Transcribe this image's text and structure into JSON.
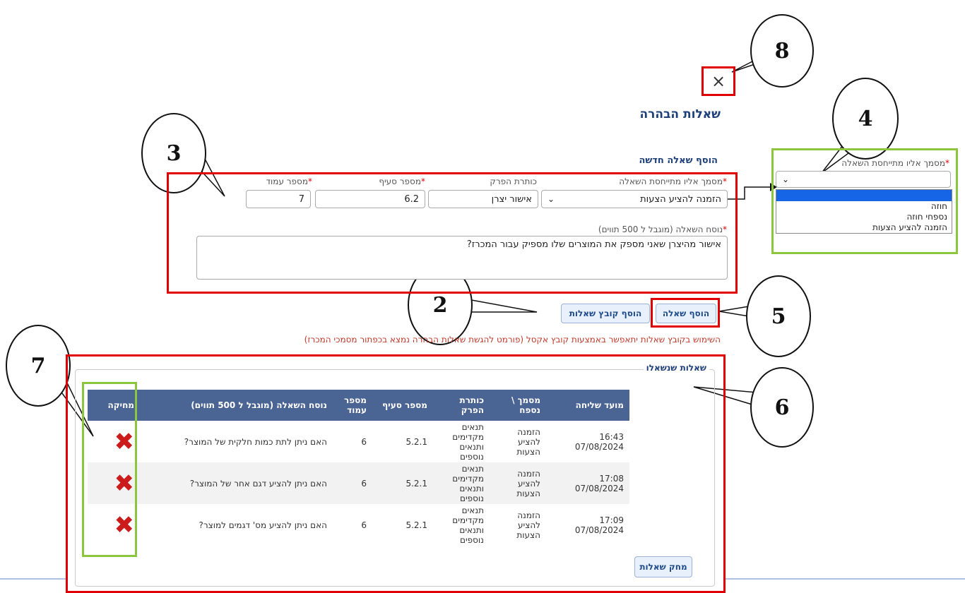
{
  "dialog": {
    "title": "שאלות הבהרה",
    "close_icon": "close-icon",
    "close_glyph": "×"
  },
  "new_question": {
    "section_title": "הוסף שאלה חדשה",
    "document_label": "מסמך אליו מתייחסת השאלה",
    "document_value": "הזמנה להציע הצעות",
    "chapter_label": "כותרת הפרק",
    "chapter_value": "אישור יצרן",
    "section_label": "מספר סעיף",
    "section_value": "6.2",
    "page_label": "מספר עמוד",
    "page_value": "7",
    "text_label": "נוסח השאלה (מוגבל ל 500 תווים)",
    "text_value": "אישור מהיצרן שאני מספק את המוצרים שלו מספיק עבור המכרז?",
    "required_mark": "*"
  },
  "dropdown_zoom": {
    "label": "מסמך אליו מתייחסת השאלה",
    "options": [
      "",
      "חוזה",
      "נספחי חוזה",
      "הזמנה להציע הצעות"
    ]
  },
  "buttons": {
    "add_question": "הוסף שאלה",
    "add_file": "הוסף קובץ שאלות",
    "delete_questions": "מחק שאלות"
  },
  "note": "השימוש בקובץ שאלות יתאפשר באמצעות קובץ אקסל (פורמט להגשת שאלות הבהרה נמצא בכפתור מסמכי המכרז)",
  "asked": {
    "legend": "שאלות שנשאלו",
    "columns": [
      "מועד שליחה",
      "מסמך \\ נספח",
      "כותרת הפרק",
      "מספר סעיף",
      "מספר עמוד",
      "נוסח השאלה (מוגבל ל 500 תווים)",
      "מחיקה"
    ],
    "rows": [
      {
        "date": "16:43 07/08/2024",
        "doc": "הזמנה להציע הצעות",
        "chapter": "תנאים מקדימים ותנאים נוספים",
        "section": "5.2.1",
        "page": "6",
        "text": "האם ניתן לתת כמות חלקית של המוצר?"
      },
      {
        "date": "17:08 07/08/2024",
        "doc": "הזמנה להציע הצעות",
        "chapter": "תנאים מקדימים ותנאים נוספים",
        "section": "5.2.1",
        "page": "6",
        "text": "האם ניתן להציע דגם אחר של המוצר?"
      },
      {
        "date": "17:09 07/08/2024",
        "doc": "הזמנה להציע הצעות",
        "chapter": "תנאים מקדימים ותנאים נוספים",
        "section": "5.2.1",
        "page": "6",
        "text": "האם ניתן להציע מס' דגמים למוצר?"
      }
    ],
    "delete_icon": "delete-x-icon",
    "delete_glyph": "✖"
  },
  "callouts": [
    "8",
    "4",
    "3",
    "2",
    "5",
    "7",
    "6"
  ],
  "colors": {
    "highlight_red": "#e00000",
    "highlight_green": "#8cc63f",
    "header_blue": "#4a6494",
    "title_blue": "#1d3f7a"
  }
}
